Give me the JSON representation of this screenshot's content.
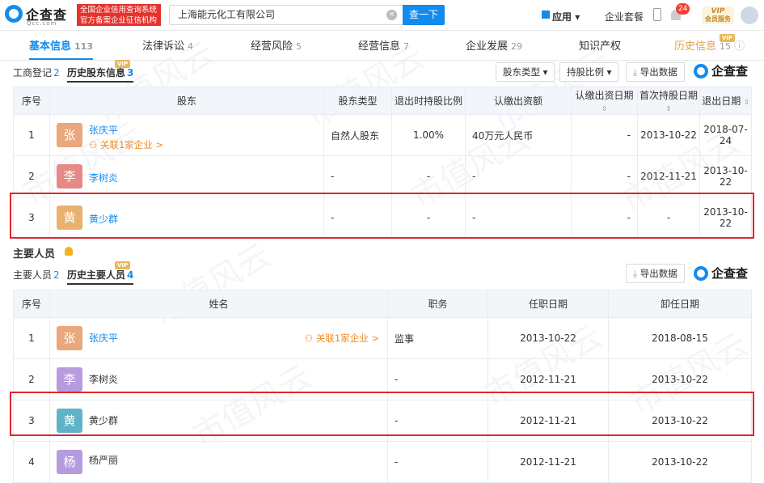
{
  "header": {
    "logo_text": "企查查",
    "logo_sub": "Qcc.com",
    "slogan_line1": "全国企业信用查询系统",
    "slogan_line2": "官方备案企业征信机构",
    "search_value": "上海能元化工有限公司",
    "search_button": "查一下",
    "app_label": "应用",
    "package_label": "企业套餐",
    "notification_count": "24",
    "vip_label": "VIP",
    "vip_sub": "会员服务"
  },
  "tabs": [
    {
      "label": "基本信息",
      "count": "113"
    },
    {
      "label": "法律诉讼",
      "count": "4"
    },
    {
      "label": "经营风险",
      "count": "5"
    },
    {
      "label": "经营信息",
      "count": "7"
    },
    {
      "label": "企业发展",
      "count": "29"
    },
    {
      "label": "知识产权",
      "count": ""
    },
    {
      "label": "历史信息",
      "count": "15"
    }
  ],
  "vip_tag": "VIP",
  "shareholders": {
    "subtab1_label": "工商登记",
    "subtab1_count": "2",
    "subtab2_label": "历史股东信息",
    "subtab2_count": "3",
    "filter_type": "股东类型",
    "filter_ratio": "持股比例",
    "export": "导出数据",
    "brand": "企查查",
    "columns": [
      "序号",
      "股东",
      "股东类型",
      "退出时持股比例",
      "认缴出资额",
      "认缴出资日期",
      "首次持股日期",
      "退出日期"
    ],
    "rows": [
      {
        "no": "1",
        "avatar": "张",
        "name": "张庆平",
        "link": "关联1家企业 >",
        "type": "自然人股东",
        "ratio": "1.00%",
        "capital": "40万元人民币",
        "cap_date": "-",
        "first_date": "2013-10-22",
        "exit_date": "2018-07-24"
      },
      {
        "no": "2",
        "avatar": "李",
        "name": "李树炎",
        "link": "",
        "type": "-",
        "ratio": "-",
        "capital": "-",
        "cap_date": "-",
        "first_date": "2012-11-21",
        "exit_date": "2013-10-22"
      },
      {
        "no": "3",
        "avatar": "黄",
        "name": "黄少群",
        "link": "",
        "type": "-",
        "ratio": "-",
        "capital": "-",
        "cap_date": "-",
        "first_date": "-",
        "exit_date": "2013-10-22"
      }
    ]
  },
  "personnel": {
    "section_title": "主要人员",
    "subtab1_label": "主要人员",
    "subtab1_count": "2",
    "subtab2_label": "历史主要人员",
    "subtab2_count": "4",
    "export": "导出数据",
    "brand": "企查查",
    "columns": [
      "序号",
      "姓名",
      "职务",
      "任职日期",
      "卸任日期"
    ],
    "rows": [
      {
        "no": "1",
        "avatar": "张",
        "name": "张庆平",
        "link": "关联1家企业 >",
        "role": "监事",
        "start": "2013-10-22",
        "end": "2018-08-15"
      },
      {
        "no": "2",
        "avatar": "李",
        "name": "李树炎",
        "link": "",
        "role": "-",
        "start": "2012-11-21",
        "end": "2013-10-22"
      },
      {
        "no": "3",
        "avatar": "黄",
        "name": "黄少群",
        "link": "",
        "role": "-",
        "start": "2012-11-21",
        "end": "2013-10-22"
      },
      {
        "no": "4",
        "avatar": "杨",
        "name": "杨严丽",
        "link": "",
        "role": "-",
        "start": "2012-11-21",
        "end": "2013-10-22"
      }
    ]
  },
  "colors": {
    "accent": "#128bed",
    "highlight": "#e0262d",
    "avatar_zhang": "#e8a77d",
    "avatar_li": "#e58a86",
    "avatar_huang": "#e8b16f",
    "avatar_li2": "#b79be0",
    "avatar_huang2": "#5fb3c9",
    "avatar_yang": "#b79be0"
  },
  "watermark": "市值风云"
}
